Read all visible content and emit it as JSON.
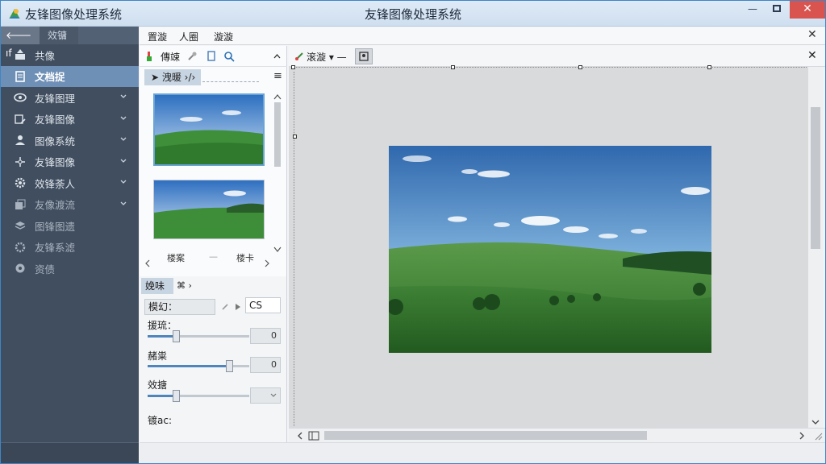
{
  "window": {
    "title_left": "友锋图像处理系统",
    "title_center": "友锋图像处理系统",
    "minimize": "—",
    "close": "✕"
  },
  "sidebar": {
    "back_label": "🡐 ıf",
    "tab2_label": "效镛",
    "items": [
      {
        "label": "共像",
        "icon": "share-icon"
      },
      {
        "label": "文档捉",
        "icon": "document-icon"
      },
      {
        "label": "友锋图理",
        "icon": "eye-icon"
      },
      {
        "label": "友锋图像",
        "icon": "image-edit-icon"
      },
      {
        "label": "图像系统",
        "icon": "user-icon"
      },
      {
        "label": "友锋图像",
        "icon": "adjust-icon"
      },
      {
        "label": "效锋荼人",
        "icon": "gear-icon"
      },
      {
        "label": "友像渡流",
        "icon": "stack-icon"
      },
      {
        "label": "图锋图遗",
        "icon": "layers-icon"
      },
      {
        "label": "友锋系滤",
        "icon": "cog-icon"
      },
      {
        "label": "资债",
        "icon": "globe-icon"
      }
    ]
  },
  "menu": {
    "items": [
      "置漩",
      "人圈",
      "漩漩"
    ],
    "close": "✕"
  },
  "left_panel": {
    "toolbar_label": "傳竦",
    "tab_label": "➤ 洩暖 ›/›",
    "menu_icon": "≡",
    "captions": [
      "楼案",
      "—",
      "楼卡"
    ]
  },
  "props": {
    "tab_label": "娩味",
    "tab2_label": "⌘ ›",
    "mode_label": "模幻：",
    "mode_value": "",
    "cs_value": "CS",
    "slider1_label": "援琉：",
    "slider1_value": "0",
    "slider1_level": 0.28,
    "slider2_label": "赭粜",
    "slider2_value": "0",
    "slider2_level": 0.8,
    "slider3_label": "效搪",
    "slider3_level": 0.28,
    "footer_label": "镀ac:"
  },
  "canvas_toolbar": {
    "label": "滚漩 ▾ —",
    "close": "✕"
  },
  "colors": {
    "accent": "#4f84bd",
    "sidebar_bg": "#414e5f",
    "sidebar_active": "#6f90b6"
  }
}
